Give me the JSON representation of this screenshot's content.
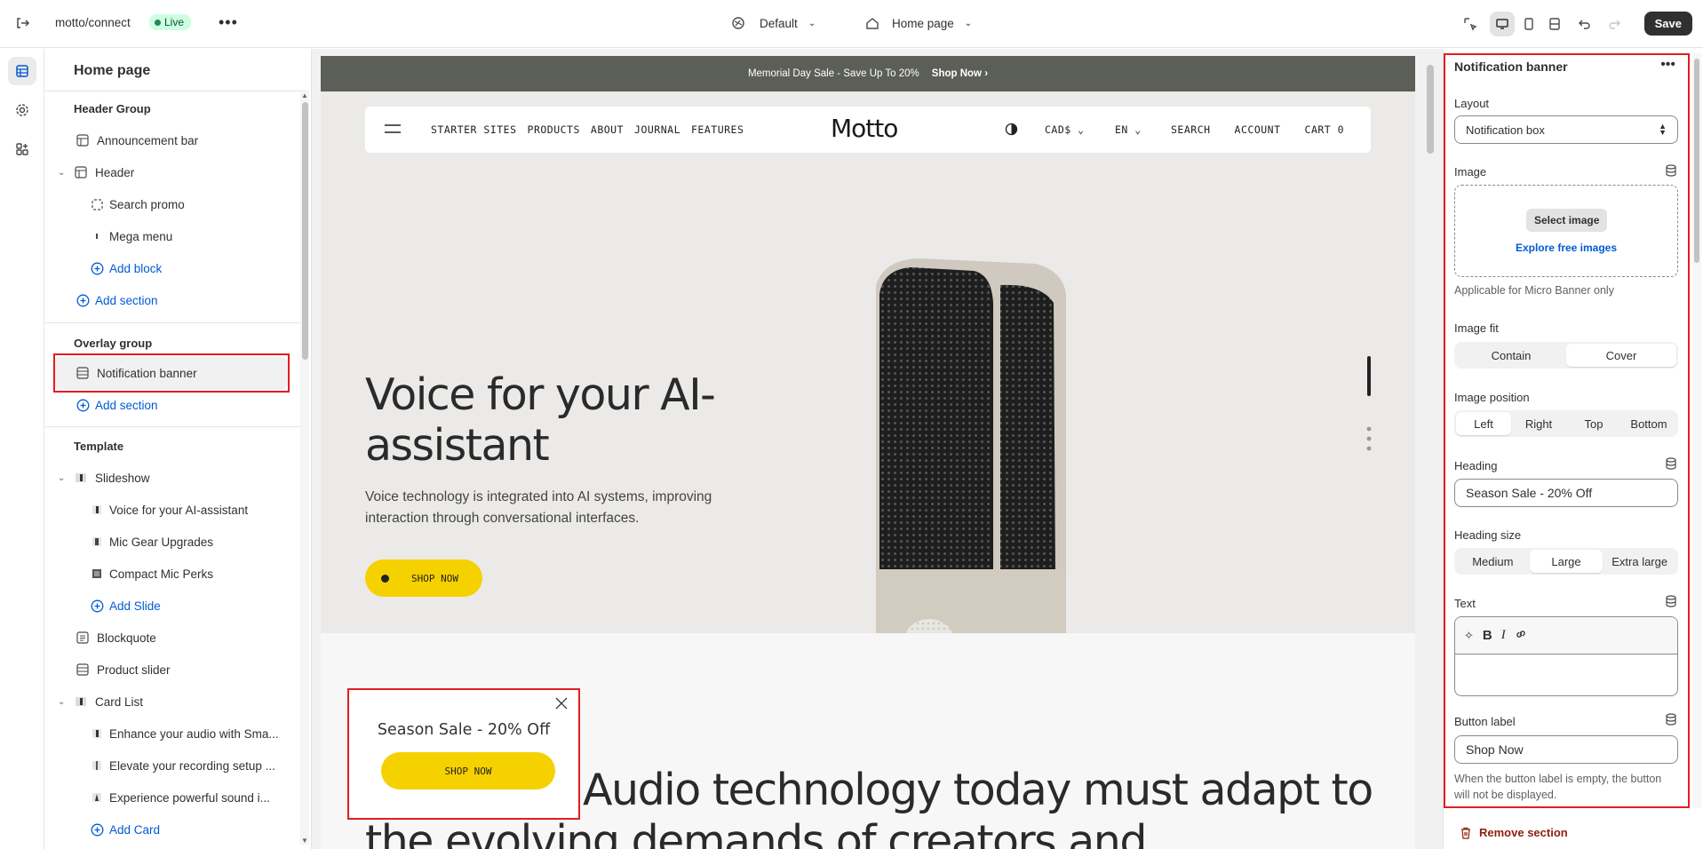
{
  "topbar": {
    "store": "motto/connect",
    "status": "Live",
    "theme": "Default",
    "page": "Home page",
    "save": "Save"
  },
  "left": {
    "title": "Home page",
    "header_group": "Header Group",
    "announcement_bar": "Announcement bar",
    "header": "Header",
    "search_promo": "Search promo",
    "mega_menu": "Mega menu",
    "add_block": "Add block",
    "add_section": "Add section",
    "overlay_group": "Overlay group",
    "notification_banner": "Notification banner",
    "template": "Template",
    "slideshow": "Slideshow",
    "slides": [
      "Voice for your AI-assistant",
      "Mic Gear Upgrades",
      "Compact Mic Perks"
    ],
    "add_slide": "Add Slide",
    "blockquote": "Blockquote",
    "product_slider": "Product slider",
    "card_list": "Card List",
    "cards": [
      "Enhance your audio with Sma...",
      "Elevate your recording setup ...",
      "Experience powerful sound i..."
    ],
    "add_card": "Add Card"
  },
  "preview": {
    "announcement": "Memorial Day Sale - Save Up To 20%",
    "announcement_link": "Shop Now",
    "nav_links": [
      "STARTER SITES",
      "PRODUCTS",
      "ABOUT",
      "JOURNAL",
      "FEATURES"
    ],
    "logo": "Motto",
    "currency": "CAD$",
    "language": "EN",
    "nav_right": [
      "SEARCH",
      "ACCOUNT",
      "CART 0"
    ],
    "hero_heading": "Voice for your AI-assistant",
    "hero_text": "Voice technology is integrated into AI systems, improving interaction through conversational interfaces.",
    "hero_button": "SHOP NOW",
    "lower_heading_1": "Audio technology today must adapt to",
    "lower_heading_2": "the evolving demands of creators and",
    "popup_heading": "Season Sale - 20% Off",
    "popup_button": "SHOP NOW"
  },
  "settings": {
    "title": "Notification banner",
    "layout_label": "Layout",
    "layout_value": "Notification box",
    "image_label": "Image",
    "select_image": "Select image",
    "explore_images": "Explore free images",
    "image_help": "Applicable for Micro Banner only",
    "image_fit_label": "Image fit",
    "image_fit_options": [
      "Contain",
      "Cover"
    ],
    "image_fit_selected": "Cover",
    "image_position_label": "Image position",
    "image_position_options": [
      "Left",
      "Right",
      "Top",
      "Bottom"
    ],
    "image_position_selected": "Left",
    "heading_label": "Heading",
    "heading_value": "Season Sale - 20% Off",
    "heading_size_label": "Heading size",
    "heading_size_options": [
      "Medium",
      "Large",
      "Extra large"
    ],
    "heading_size_selected": "Large",
    "text_label": "Text",
    "text_value": "",
    "button_label_label": "Button label",
    "button_label_value": "Shop Now",
    "button_help": "When the button label is empty, the button will not be displayed.",
    "remove": "Remove section"
  },
  "colors": {
    "accent_yellow": "#f6d100",
    "annotation_red": "#e11d22",
    "link_blue": "#005bd3",
    "danger": "#8e1f0b"
  }
}
